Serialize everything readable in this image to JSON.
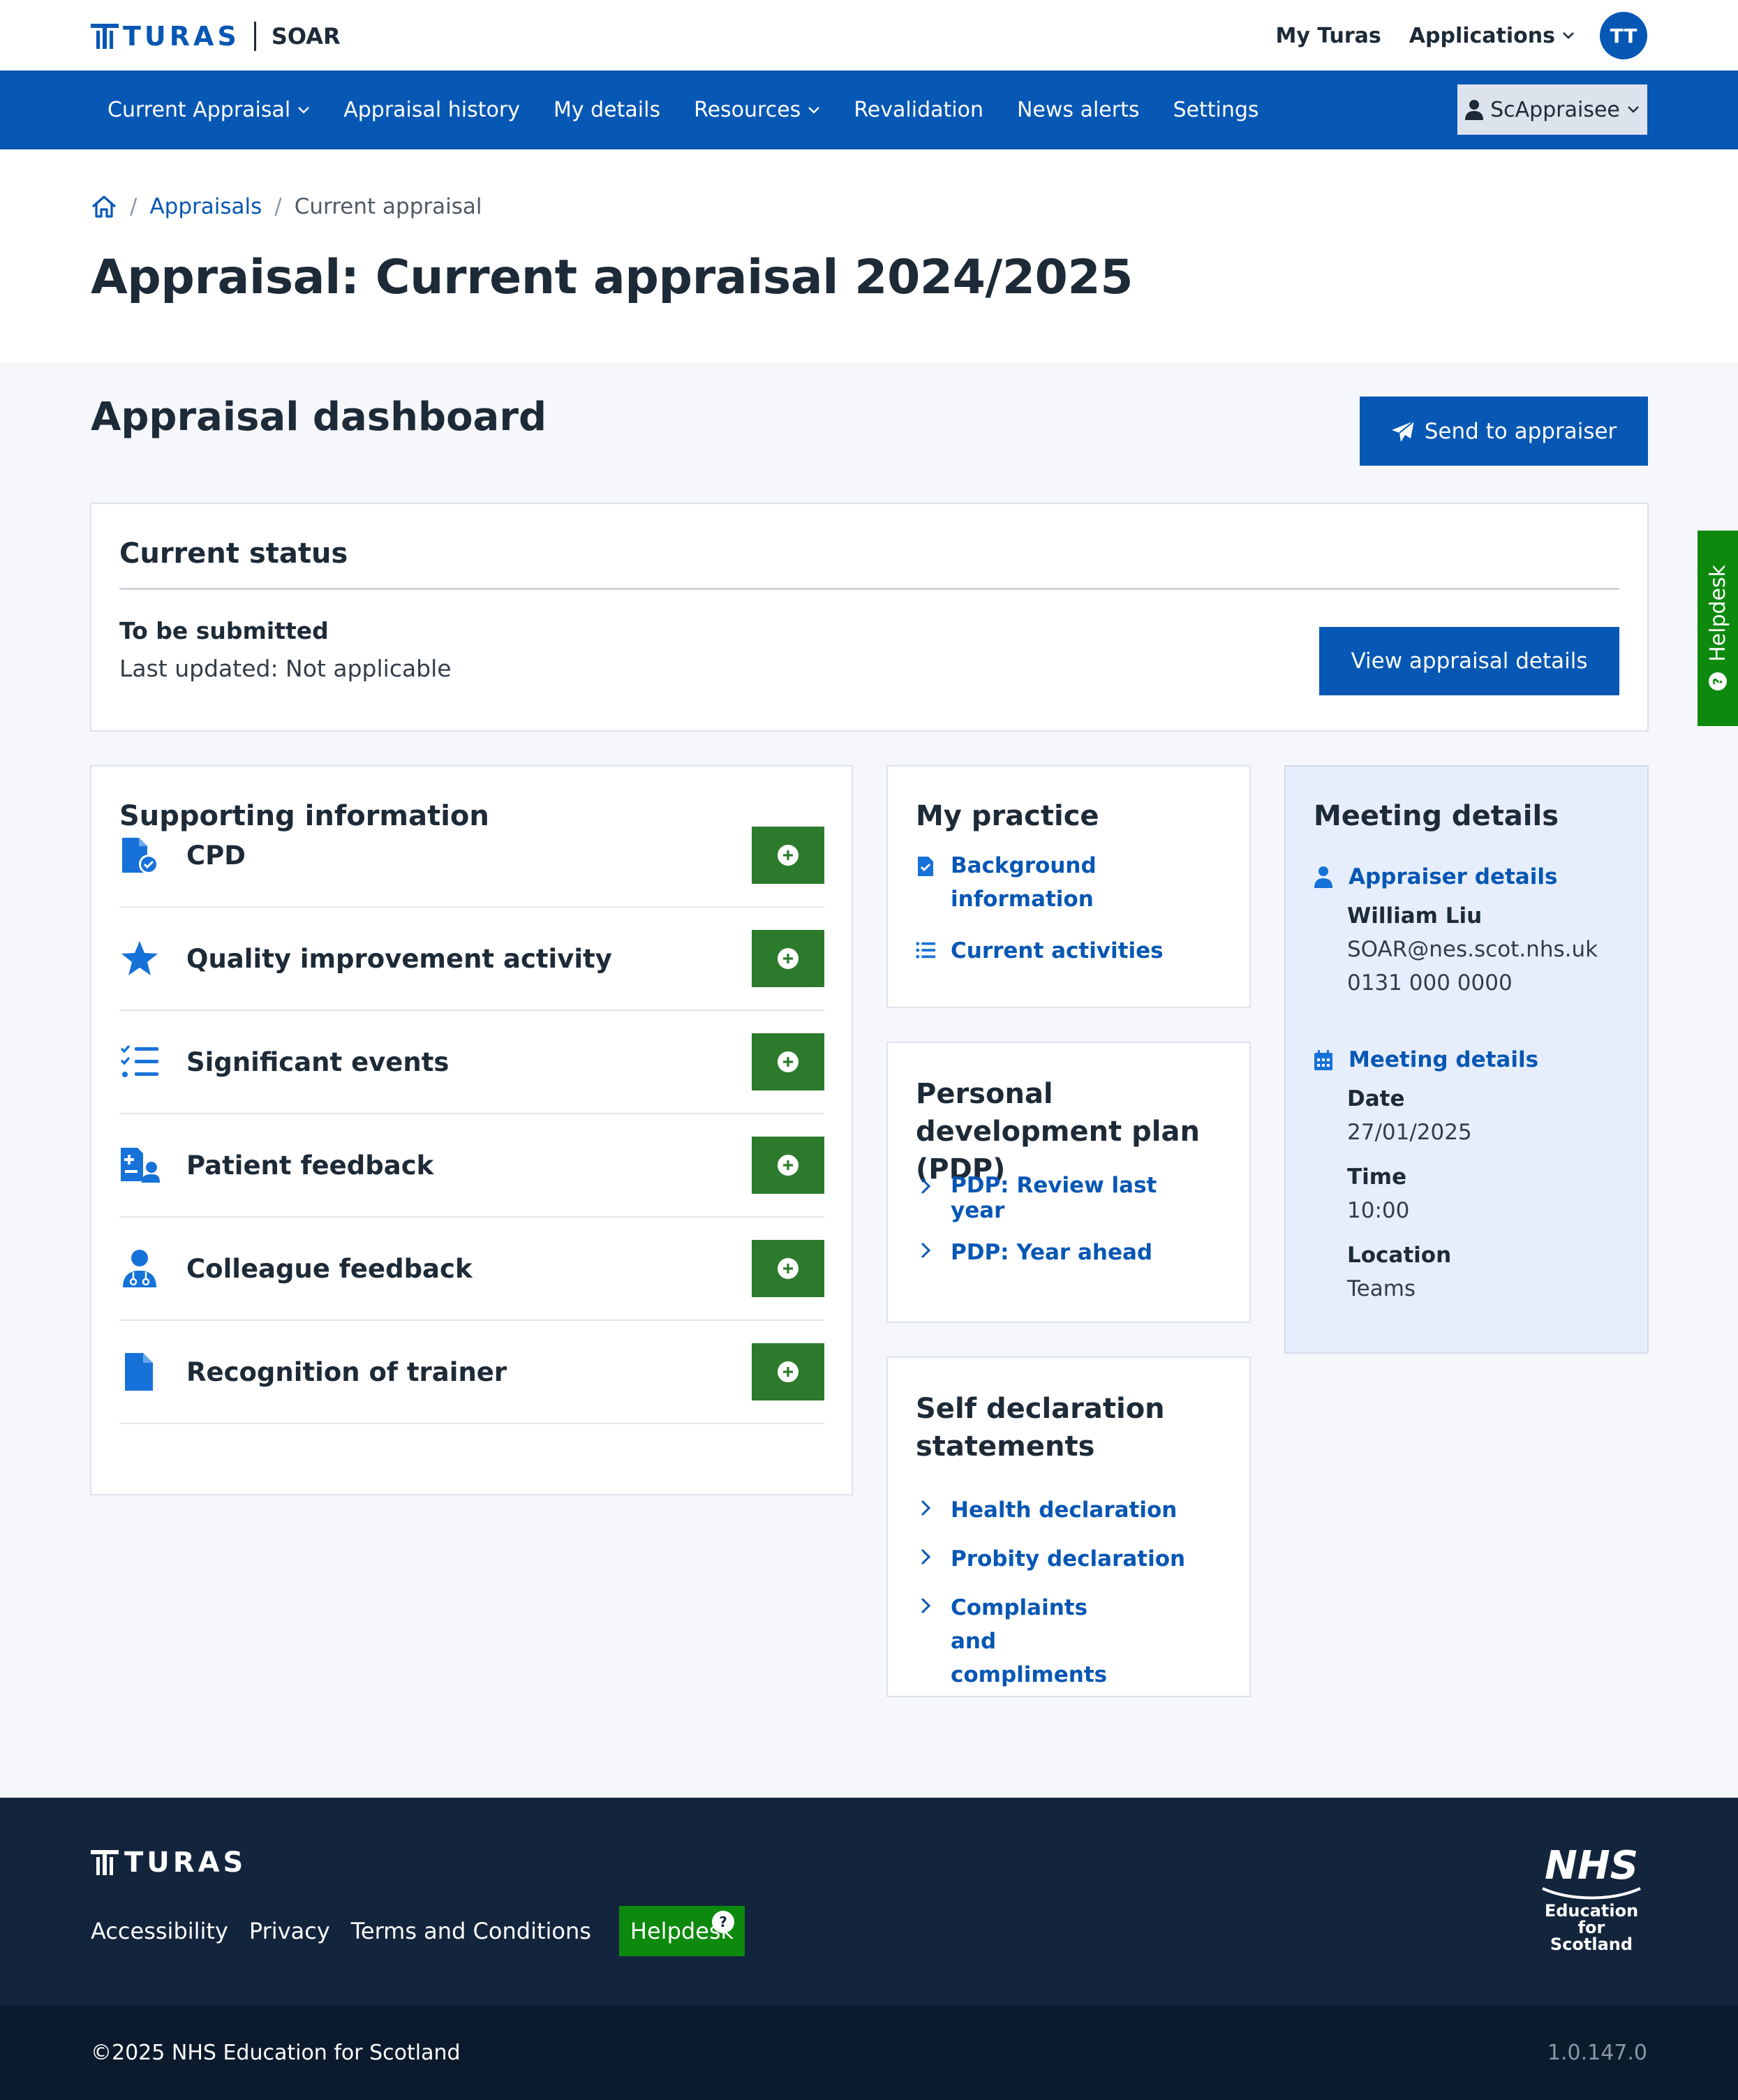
{
  "header": {
    "logo_text": "TURAS",
    "app_name": "SOAR",
    "my_turas": "My Turas",
    "applications": "Applications",
    "avatar_initials": "TT"
  },
  "nav": {
    "items": [
      {
        "label": "Current Appraisal",
        "dropdown": true
      },
      {
        "label": "Appraisal history",
        "dropdown": false
      },
      {
        "label": "My details",
        "dropdown": false
      },
      {
        "label": "Resources",
        "dropdown": true
      },
      {
        "label": "Revalidation",
        "dropdown": false
      },
      {
        "label": "News alerts",
        "dropdown": false
      },
      {
        "label": "Settings",
        "dropdown": false
      }
    ],
    "user": "ScAppraisee"
  },
  "breadcrumb": {
    "appraisals": "Appraisals",
    "current": "Current appraisal"
  },
  "page_title": "Appraisal: Current appraisal 2024/2025",
  "dashboard": {
    "title": "Appraisal dashboard",
    "send_button": "Send to appraiser"
  },
  "status": {
    "heading": "Current status",
    "state": "To be submitted",
    "last_updated": "Last updated: Not applicable",
    "view_button": "View appraisal details"
  },
  "supporting": {
    "heading": "Supporting information",
    "items": [
      {
        "label": "CPD",
        "icon": "file-check-icon"
      },
      {
        "label": "Quality improvement activity",
        "icon": "star-icon"
      },
      {
        "label": "Significant events",
        "icon": "checklist-icon"
      },
      {
        "label": "Patient feedback",
        "icon": "patient-feedback-icon"
      },
      {
        "label": "Colleague feedback",
        "icon": "doctor-icon"
      },
      {
        "label": "Recognition of trainer",
        "icon": "document-icon"
      }
    ]
  },
  "practice": {
    "heading": "My practice",
    "background": "Background information",
    "current": "Current activities"
  },
  "pdp": {
    "heading": "Personal development plan (PDP)",
    "review": "PDP: Review last year",
    "ahead": "PDP: Year ahead"
  },
  "self_decl": {
    "heading": "Self declaration statements",
    "health": "Health declaration",
    "probity": "Probity declaration",
    "complaints": "Complaints and compliments"
  },
  "meeting": {
    "heading": "Meeting details",
    "appraiser_link": "Appraiser details",
    "appraiser_name": "William Liu",
    "appraiser_email": "SOAR@nes.scot.nhs.uk",
    "appraiser_phone": "0131 000 0000",
    "meeting_link": "Meeting details",
    "date_label": "Date",
    "date": "27/01/2025",
    "time_label": "Time",
    "time": "10:00",
    "location_label": "Location",
    "location": "Teams"
  },
  "helpdesk_tab": "Helpdesk",
  "footer": {
    "logo_text": "TURAS",
    "links": [
      "Accessibility",
      "Privacy",
      "Terms and Conditions"
    ],
    "helpdesk": "Helpdesk",
    "nhs": "NHS",
    "nhs_sub1": "Education",
    "nhs_sub2": "for",
    "nhs_sub3": "Scotland",
    "copyright": "©2025 NHS Education for Scotland",
    "version": "1.0.147.0"
  },
  "colors": {
    "primary": "#0757b4",
    "success": "#2c7a2c",
    "helpdesk": "#0d8a0d",
    "footer": "#13253d"
  }
}
